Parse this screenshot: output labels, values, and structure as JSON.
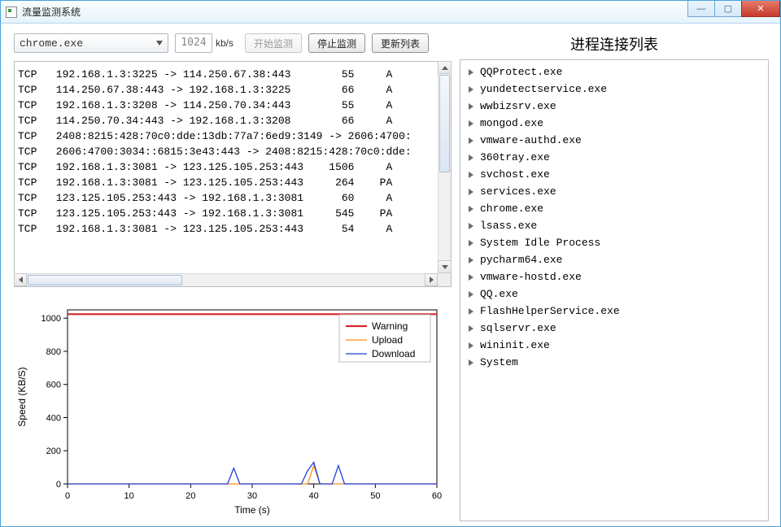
{
  "window": {
    "title": "流量监测系统"
  },
  "toolbar": {
    "process_selected": "chrome.exe",
    "threshold_value": "1024",
    "threshold_unit": "kb/s",
    "start_label": "开始监测",
    "stop_label": "停止监测",
    "refresh_label": "更新列表"
  },
  "right": {
    "title": "进程连接列表",
    "items": [
      "QQProtect.exe",
      "yundetectservice.exe",
      "wwbizsrv.exe",
      "mongod.exe",
      "vmware-authd.exe",
      "360tray.exe",
      "svchost.exe",
      "services.exe",
      "chrome.exe",
      "lsass.exe",
      "System Idle Process",
      "pycharm64.exe",
      "vmware-hostd.exe",
      "QQ.exe",
      "FlashHelperService.exe",
      "sqlservr.exe",
      "wininit.exe",
      "System"
    ]
  },
  "log": {
    "rows": [
      {
        "proto": "TCP",
        "text": "192.168.1.3:3225 -> 114.250.67.38:443",
        "bytes": "55",
        "flags": "A"
      },
      {
        "proto": "TCP",
        "text": "114.250.67.38:443 -> 192.168.1.3:3225",
        "bytes": "66",
        "flags": "A"
      },
      {
        "proto": "TCP",
        "text": "192.168.1.3:3208 -> 114.250.70.34:443",
        "bytes": "55",
        "flags": "A"
      },
      {
        "proto": "TCP",
        "text": "114.250.70.34:443 -> 192.168.1.3:3208",
        "bytes": "66",
        "flags": "A"
      },
      {
        "proto": "TCP",
        "text": "2408:8215:428:70c0:dde:13db:77a7:6ed9:3149 -> 2606:4700:",
        "bytes": "",
        "flags": ""
      },
      {
        "proto": "TCP",
        "text": "2606:4700:3034::6815:3e43:443 -> 2408:8215:428:70c0:dde:",
        "bytes": "",
        "flags": ""
      },
      {
        "proto": "TCP",
        "text": "192.168.1.3:3081 -> 123.125.105.253:443",
        "bytes": "1506",
        "flags": "A"
      },
      {
        "proto": "TCP",
        "text": "192.168.1.3:3081 -> 123.125.105.253:443",
        "bytes": "264",
        "flags": "PA"
      },
      {
        "proto": "TCP",
        "text": "123.125.105.253:443 -> 192.168.1.3:3081",
        "bytes": "60",
        "flags": "A"
      },
      {
        "proto": "TCP",
        "text": "123.125.105.253:443 -> 192.168.1.3:3081",
        "bytes": "545",
        "flags": "PA"
      },
      {
        "proto": "TCP",
        "text": "192.168.1.3:3081 -> 123.125.105.253:443",
        "bytes": "54",
        "flags": "A"
      }
    ]
  },
  "chart_data": {
    "type": "line",
    "title": "",
    "xlabel": "Time (s)",
    "ylabel": "Speed (KB/S)",
    "xlim": [
      0,
      60
    ],
    "ylim": [
      0,
      1050
    ],
    "xticks": [
      0,
      10,
      20,
      30,
      40,
      50,
      60
    ],
    "yticks": [
      0,
      200,
      400,
      600,
      800,
      1000
    ],
    "legend": [
      "Warning",
      "Upload",
      "Download"
    ],
    "series": [
      {
        "name": "Warning",
        "color": "#d62728",
        "x": [
          0,
          60
        ],
        "y": [
          1024,
          1024
        ]
      },
      {
        "name": "Upload",
        "color": "#ff8c1a",
        "x": [
          0,
          26,
          27,
          28,
          38,
          39,
          40,
          41,
          43,
          44,
          45,
          46,
          60
        ],
        "y": [
          0,
          0,
          0,
          0,
          0,
          0,
          110,
          0,
          0,
          0,
          0,
          0,
          0
        ]
      },
      {
        "name": "Download",
        "color": "#1f3fd6",
        "x": [
          0,
          26,
          27,
          28,
          38,
          39,
          40,
          41,
          43,
          44,
          45,
          46,
          60
        ],
        "y": [
          0,
          0,
          95,
          0,
          0,
          80,
          130,
          0,
          0,
          110,
          0,
          0,
          0
        ]
      }
    ]
  }
}
